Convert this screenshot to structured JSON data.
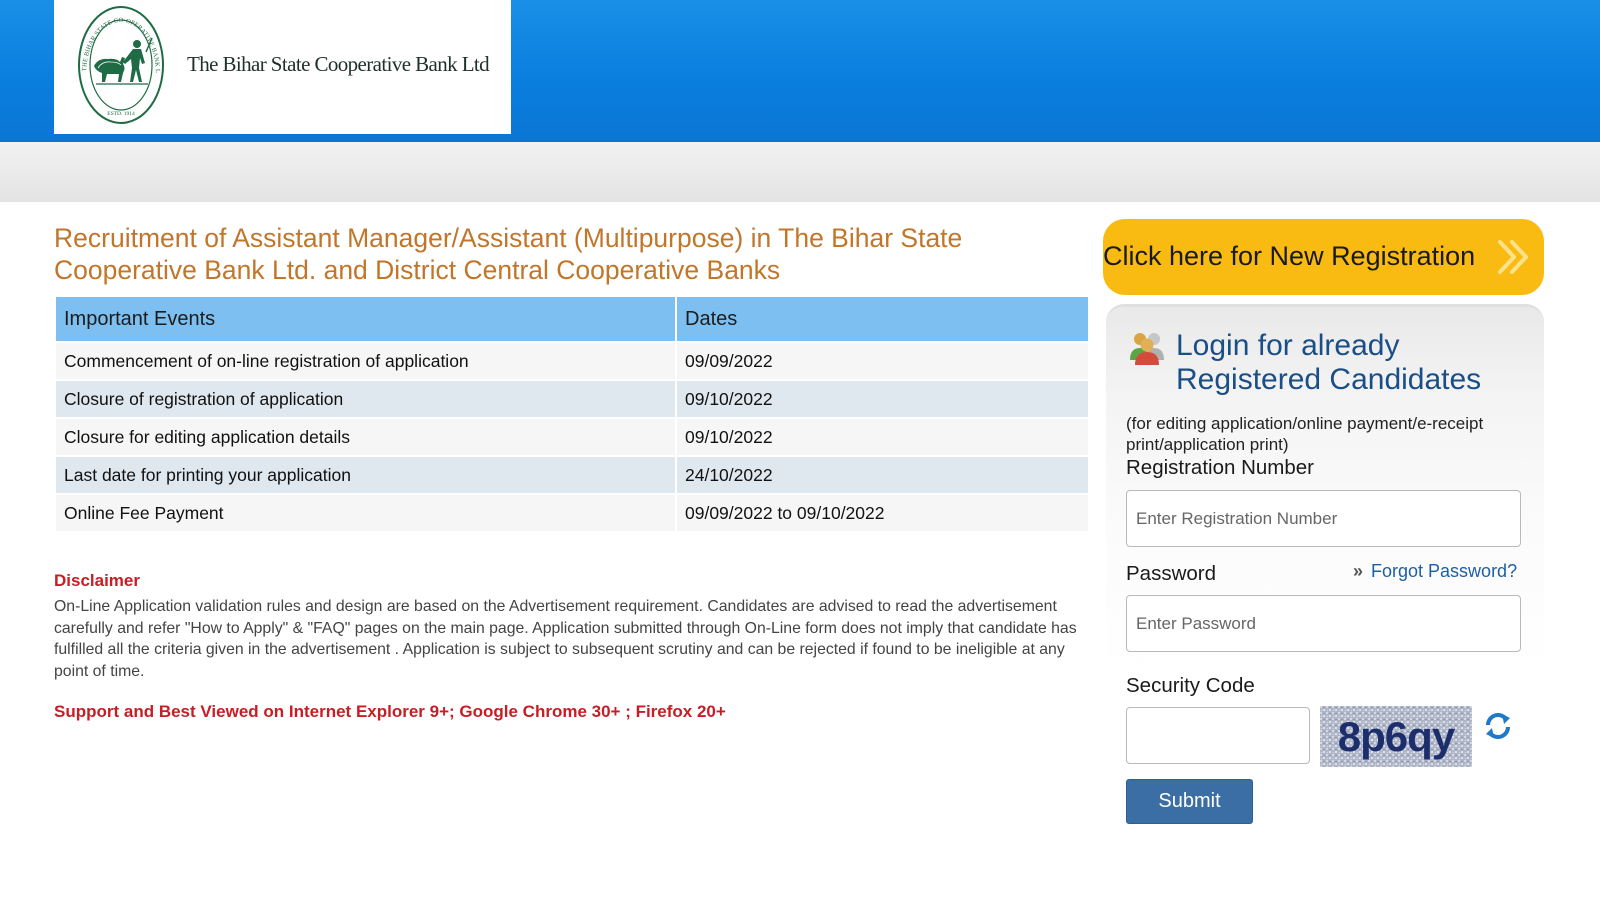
{
  "header": {
    "bank_name": "The Bihar State Cooperative Bank Ltd",
    "seal_text": "THE BIHAR STATE CO-OPERATIVE BANK LTD. PATNA",
    "seal_est": "ESTD. 1914",
    "colors": {
      "header_blue": "#0a7fde",
      "seal_green": "#1f6b45"
    }
  },
  "main": {
    "title": "Recruitment of Assistant Manager/Assistant (Multipurpose) in The Bihar State Cooperative Bank Ltd. and District Central Cooperative Banks",
    "events_table": {
      "headers": [
        "Important Events",
        "Dates"
      ],
      "rows": [
        [
          "Commencement of on-line registration of application",
          "09/09/2022"
        ],
        [
          "Closure of registration of application",
          "09/10/2022"
        ],
        [
          "Closure for editing application details",
          "09/10/2022"
        ],
        [
          "Last date for printing your application",
          "24/10/2022"
        ],
        [
          "Online Fee Payment",
          "09/09/2022 to 09/10/2022"
        ]
      ]
    },
    "disclaimer_heading": "Disclaimer",
    "disclaimer_text": "On-Line Application validation rules and design are based on the Advertisement requirement. Candidates are advised to read the advertisement carefully and refer \"How to Apply\" & \"FAQ\" pages on the main page. Application submitted through On-Line form does not imply that candidate has fulfilled all the criteria given in the advertisement . Application is subject to subsequent scrutiny and can be rejected if found to be ineligible at any point of time.",
    "support_text": "Support and Best Viewed on Internet Explorer 9+; Google Chrome 30+ ; Firefox 20+"
  },
  "sidebar": {
    "new_registration_label": "Click here for New Registration",
    "login": {
      "title_line1": "Login for already",
      "title_line2": "Registered Candidates",
      "subtitle": "(for editing application/online payment/e-receipt print/application print)",
      "registration_label": "Registration Number",
      "registration_placeholder": "Enter Registration Number",
      "password_label": "Password",
      "password_placeholder": "Enter Password",
      "forgot_password": "Forgot Password?",
      "security_code_label": "Security Code",
      "captcha_text": "8p6qy",
      "submit_label": "Submit"
    },
    "icons": {
      "new_registration": "double-chevron-right-icon",
      "login": "users-icon",
      "refresh": "refresh-icon"
    },
    "colors": {
      "accent_yellow": "#f9bb12",
      "title_blue": "#1a4e86",
      "submit_blue": "#3c6ea6"
    }
  }
}
